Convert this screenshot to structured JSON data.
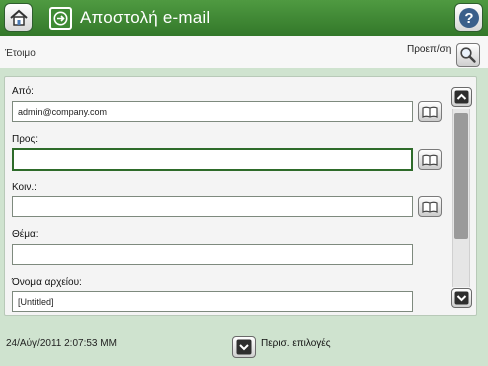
{
  "header": {
    "title": "Αποστολή e-mail"
  },
  "status": {
    "text": "Έτοιμο",
    "preview_label": "Προεπ/ση"
  },
  "fields": [
    {
      "label": "Από:",
      "value": "admin@company.com"
    },
    {
      "label": "Προς:",
      "value": ""
    },
    {
      "label": "Κοιν.:",
      "value": ""
    },
    {
      "label": "Θέμα:",
      "value": ""
    },
    {
      "label": "Όνομα αρχείου:",
      "value": "[Untitled]"
    }
  ],
  "footer": {
    "datetime": "24/Αύγ/2011 2:07:53 MM",
    "more_options_label": "Περισ. επιλογές"
  },
  "colors": {
    "header": "#3f8a35",
    "background": "#cfe3cf",
    "focus_border": "#2e6b2a"
  }
}
